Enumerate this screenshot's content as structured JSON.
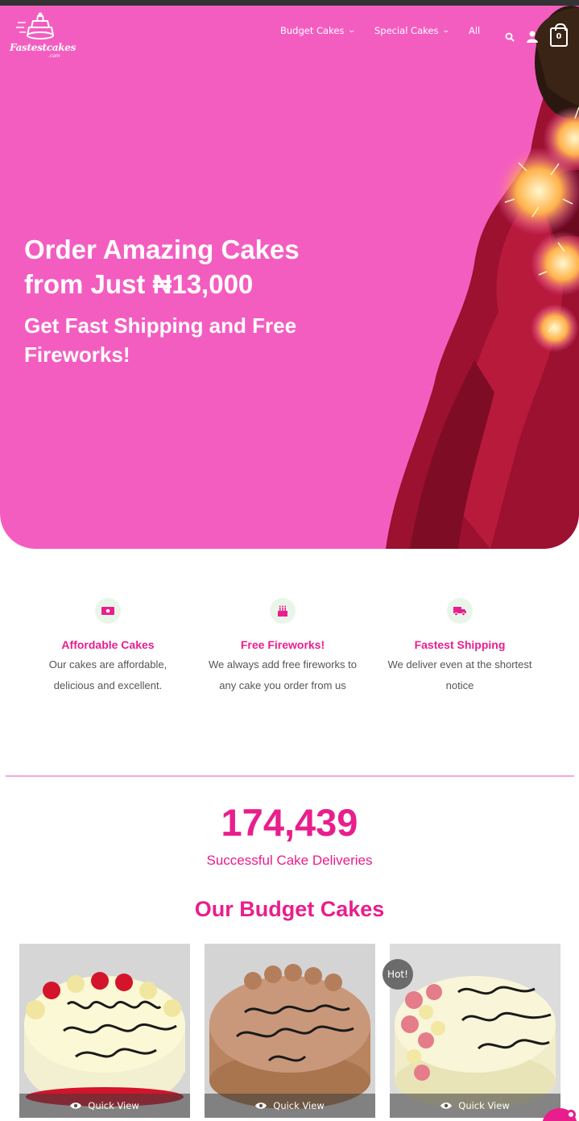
{
  "brand": {
    "logo_text": "Fastestcakes",
    "logo_sub": ".com"
  },
  "nav": {
    "items": [
      {
        "label": "Budget Cakes",
        "has_dropdown": true
      },
      {
        "label": "Special Cakes",
        "has_dropdown": true
      },
      {
        "label": "All",
        "has_dropdown": false
      }
    ],
    "icons": [
      "search-icon",
      "account-icon",
      "cart-icon"
    ],
    "cart_count": "0"
  },
  "hero": {
    "headline": "Order Amazing Cakes from Just ₦13,000",
    "subheadline": "Get Fast Shipping and Free Fireworks!",
    "background_color": "#f45dc0"
  },
  "features": [
    {
      "icon": "money-icon",
      "title": "Affordable Cakes",
      "description": "Our cakes are affordable, delicious and excellent."
    },
    {
      "icon": "cake-icon",
      "title": "Free Fireworks!",
      "description": "We always add free fireworks to any cake you order from us"
    },
    {
      "icon": "truck-icon",
      "title": "Fastest Shipping",
      "description": "We deliver even at the shortest notice"
    }
  ],
  "stats": {
    "count": "174,439",
    "label": "Successful Cake Deliveries"
  },
  "budget_section": {
    "title": "Our Budget Cakes",
    "products": [
      {
        "quick_view_label": "Quick View",
        "badge": ""
      },
      {
        "quick_view_label": "Quick View",
        "badge": ""
      },
      {
        "quick_view_label": "Quick View",
        "badge": "Hot!"
      }
    ]
  },
  "colors": {
    "accent": "#e91e8c",
    "hero_pink": "#f45dc0"
  }
}
